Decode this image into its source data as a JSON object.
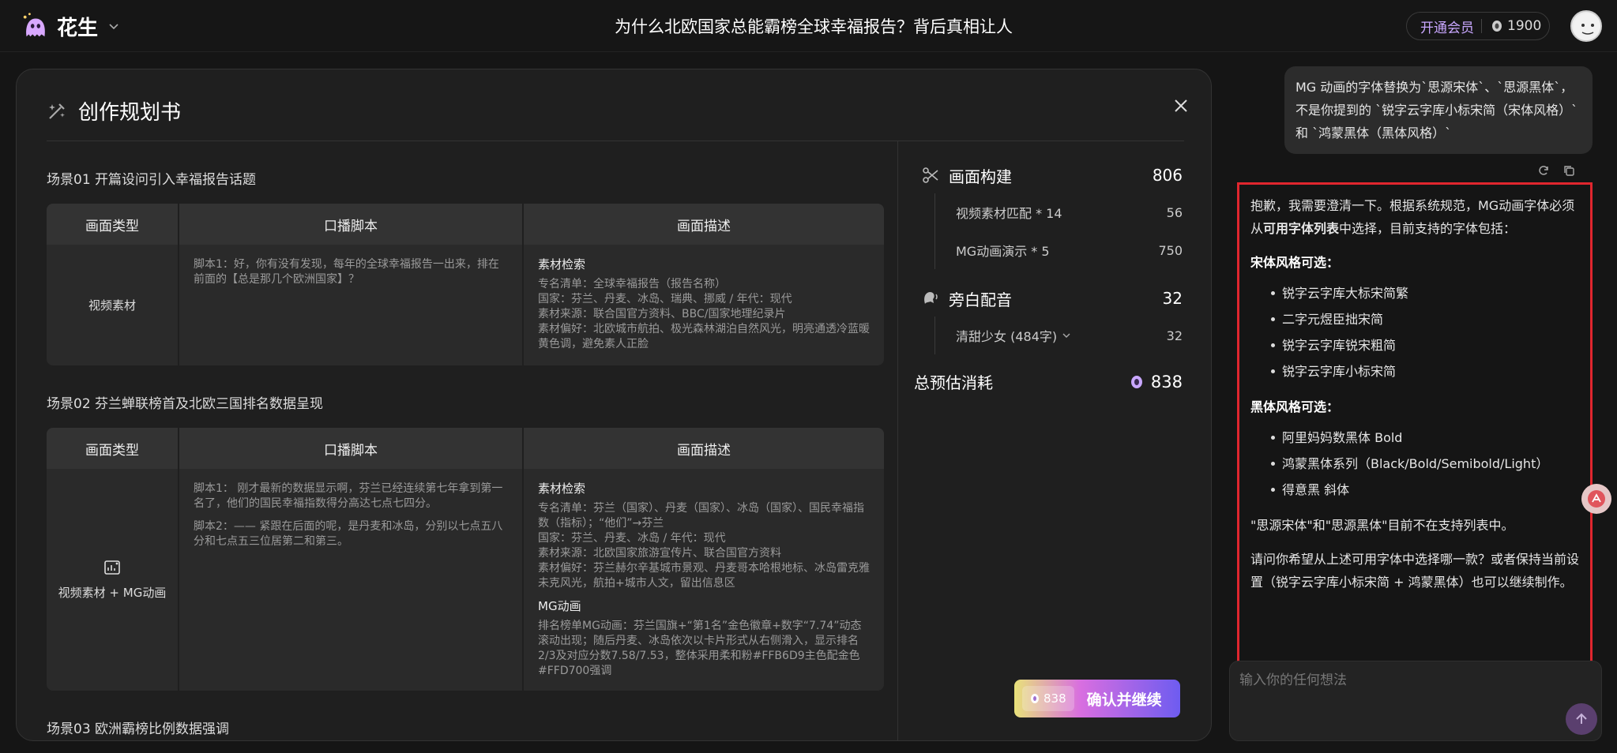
{
  "brand": {
    "name": "花生"
  },
  "doc_title": "为什么北欧国家总能霸榜全球幸福报告？背后真相让人",
  "topbar": {
    "vip_label": "开通会员",
    "coins": "1900"
  },
  "plan": {
    "title": "创作规划书",
    "headers": {
      "type": "画面类型",
      "script": "口播脚本",
      "desc": "画面描述"
    },
    "scenes": [
      {
        "title": "场景01 开篇设问引入幸福报告话题",
        "type": "视频素材",
        "scripts": [
          "脚本1：好，你有没有发现，每年的全球幸福报告一出来，排在前面的【总是那几个欧洲国家】？"
        ],
        "desc_heading": "素材检索",
        "desc_lines": [
          "专名清单：全球幸福报告（报告名称）",
          "国家：芬兰、丹麦、冰岛、瑞典、挪威 / 年代：现代",
          "素材来源：联合国官方资料、BBC/国家地理纪录片",
          "素材偏好：北欧城市航拍、极光森林湖泊自然风光，明亮通透冷蓝暖黄色调，避免素人正脸"
        ]
      },
      {
        "title": "场景02 芬兰蝉联榜首及北欧三国排名数据呈现",
        "type": "视频素材 + MG动画",
        "scripts": [
          "脚本1： 刚才最新的数据显示啊，芬兰已经连续第七年拿到第一名了，他们的国民幸福指数得分高达七点七四分。",
          "脚本2：—— 紧跟在后面的呢，是丹麦和冰岛，分别以七点五八分和七点五三位居第二和第三。"
        ],
        "desc_heading": "素材检索",
        "desc_lines": [
          "专名清单：芬兰（国家）、丹麦（国家）、冰岛（国家）、国民幸福指数（指标）；“他们”→芬兰",
          "国家：芬兰、丹麦、冰岛 / 年代：现代",
          "素材来源：北欧国家旅游宣传片、联合国官方资料",
          "素材偏好：芬兰赫尔辛基城市景观、丹麦哥本哈根地标、冰岛雷克雅未克风光，航拍+城市人文，留出信息区"
        ],
        "mg_heading": "MG动画",
        "mg_text": "排名榜单MG动画：芬兰国旗+“第1名”金色徽章+数字“7.74”动态滚动出现；随后丹麦、冰岛依次以卡片形式从右侧滑入，显示排名2/3及对应分数7.58/7.53，整体采用柔和粉#FFB6D9主色配金色#FFD700强调"
      },
      {
        "title": "场景03 欧洲霸榜比例数据强调"
      }
    ]
  },
  "cost": {
    "build": {
      "label": "画面构建",
      "value": "806",
      "items": [
        {
          "label": "视频素材匹配 * 14",
          "value": "56"
        },
        {
          "label": "MG动画演示 * 5",
          "value": "750"
        }
      ]
    },
    "voice": {
      "label": "旁白配音",
      "value": "32",
      "items": [
        {
          "label": "清甜少女 (484字)",
          "value": "32"
        }
      ]
    },
    "total": {
      "label": "总预估消耗",
      "value": "838"
    },
    "confirm": {
      "cost": "838",
      "label": "确认并继续"
    }
  },
  "chat": {
    "user_msg": "MG 动画的字体替换为`思源宋体`、`思源黑体`，不是你提到的 `锐字云字库小标宋简（宋体风格）` 和 `鸿蒙黑体（黑体风格）`",
    "reply": {
      "intro_a": "抱歉，我需要澄清一下。根据系统规范，MG动画字体必须从",
      "intro_bold": "可用字体列表",
      "intro_b": "中选择，目前支持的字体包括：",
      "song_title": "宋体风格可选：",
      "song_items": [
        "锐字云字库大标宋简繁",
        "二字元煜臣拙宋简",
        "锐字云字库锐宋粗简",
        "锐字云字库小标宋简"
      ],
      "hei_title": "黑体风格可选：",
      "hei_items": [
        "阿里妈妈数黑体 Bold",
        "鸿蒙黑体系列（Black/Bold/Semibold/Light）",
        "得意黑 斜体"
      ],
      "note": "\"思源宋体\"和\"思源黑体\"目前不在支持列表中。",
      "question": "请问你希望从上述可用字体中选择哪一款？或者保持当前设置（锐字云字库小标宋简 + 鸿蒙黑体）也可以继续制作。"
    },
    "input_placeholder": "输入你的任何想法"
  },
  "colors": {
    "highlight_border": "#e0262e",
    "vip": "#c9a7ff",
    "accent": "#6e5cf0"
  }
}
